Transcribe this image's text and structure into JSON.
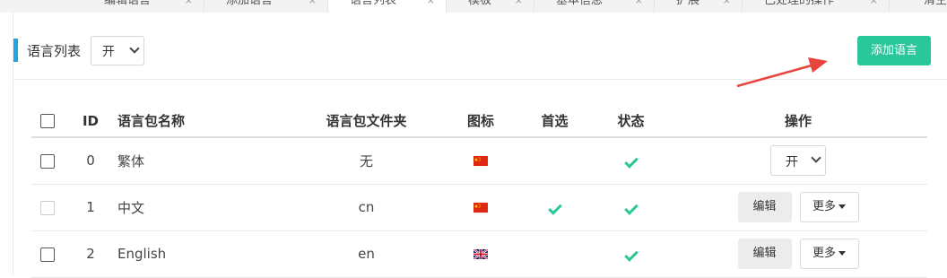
{
  "tabs": [
    {
      "label": "编辑语言",
      "close": "×"
    },
    {
      "label": "添加语言",
      "close": "×"
    },
    {
      "label": "语言列表",
      "close": "×",
      "active": true
    },
    {
      "label": "模板",
      "close": "×"
    },
    {
      "label": "基本信息",
      "close": "×"
    },
    {
      "label": "扩展",
      "close": "×"
    },
    {
      "label": "已处理的操作",
      "close": "×"
    },
    {
      "label": "清空",
      "close": ""
    }
  ],
  "header": {
    "title": "语言列表",
    "filter_value": "开",
    "add_button": "添加语言"
  },
  "table": {
    "columns": [
      "ID",
      "语言包名称",
      "语言包文件夹",
      "图标",
      "首选",
      "状态",
      "操作"
    ],
    "rows": [
      {
        "id": "0",
        "name": "繁体",
        "folder": "无",
        "flag": "cn-flag-icon",
        "preferred": false,
        "status": true,
        "action_select": "开"
      },
      {
        "id": "1",
        "name": "中文",
        "folder": "cn",
        "flag": "cn-flag-icon",
        "preferred": true,
        "status": true,
        "edit": "编辑",
        "more": "更多"
      },
      {
        "id": "2",
        "name": "English",
        "folder": "en",
        "flag": "uk-flag-icon",
        "preferred": false,
        "status": true,
        "edit": "编辑",
        "more": "更多"
      }
    ]
  },
  "colors": {
    "accent": "#2ac79b",
    "heading_bar": "#1ea5e8",
    "arrow": "#e8453c"
  }
}
